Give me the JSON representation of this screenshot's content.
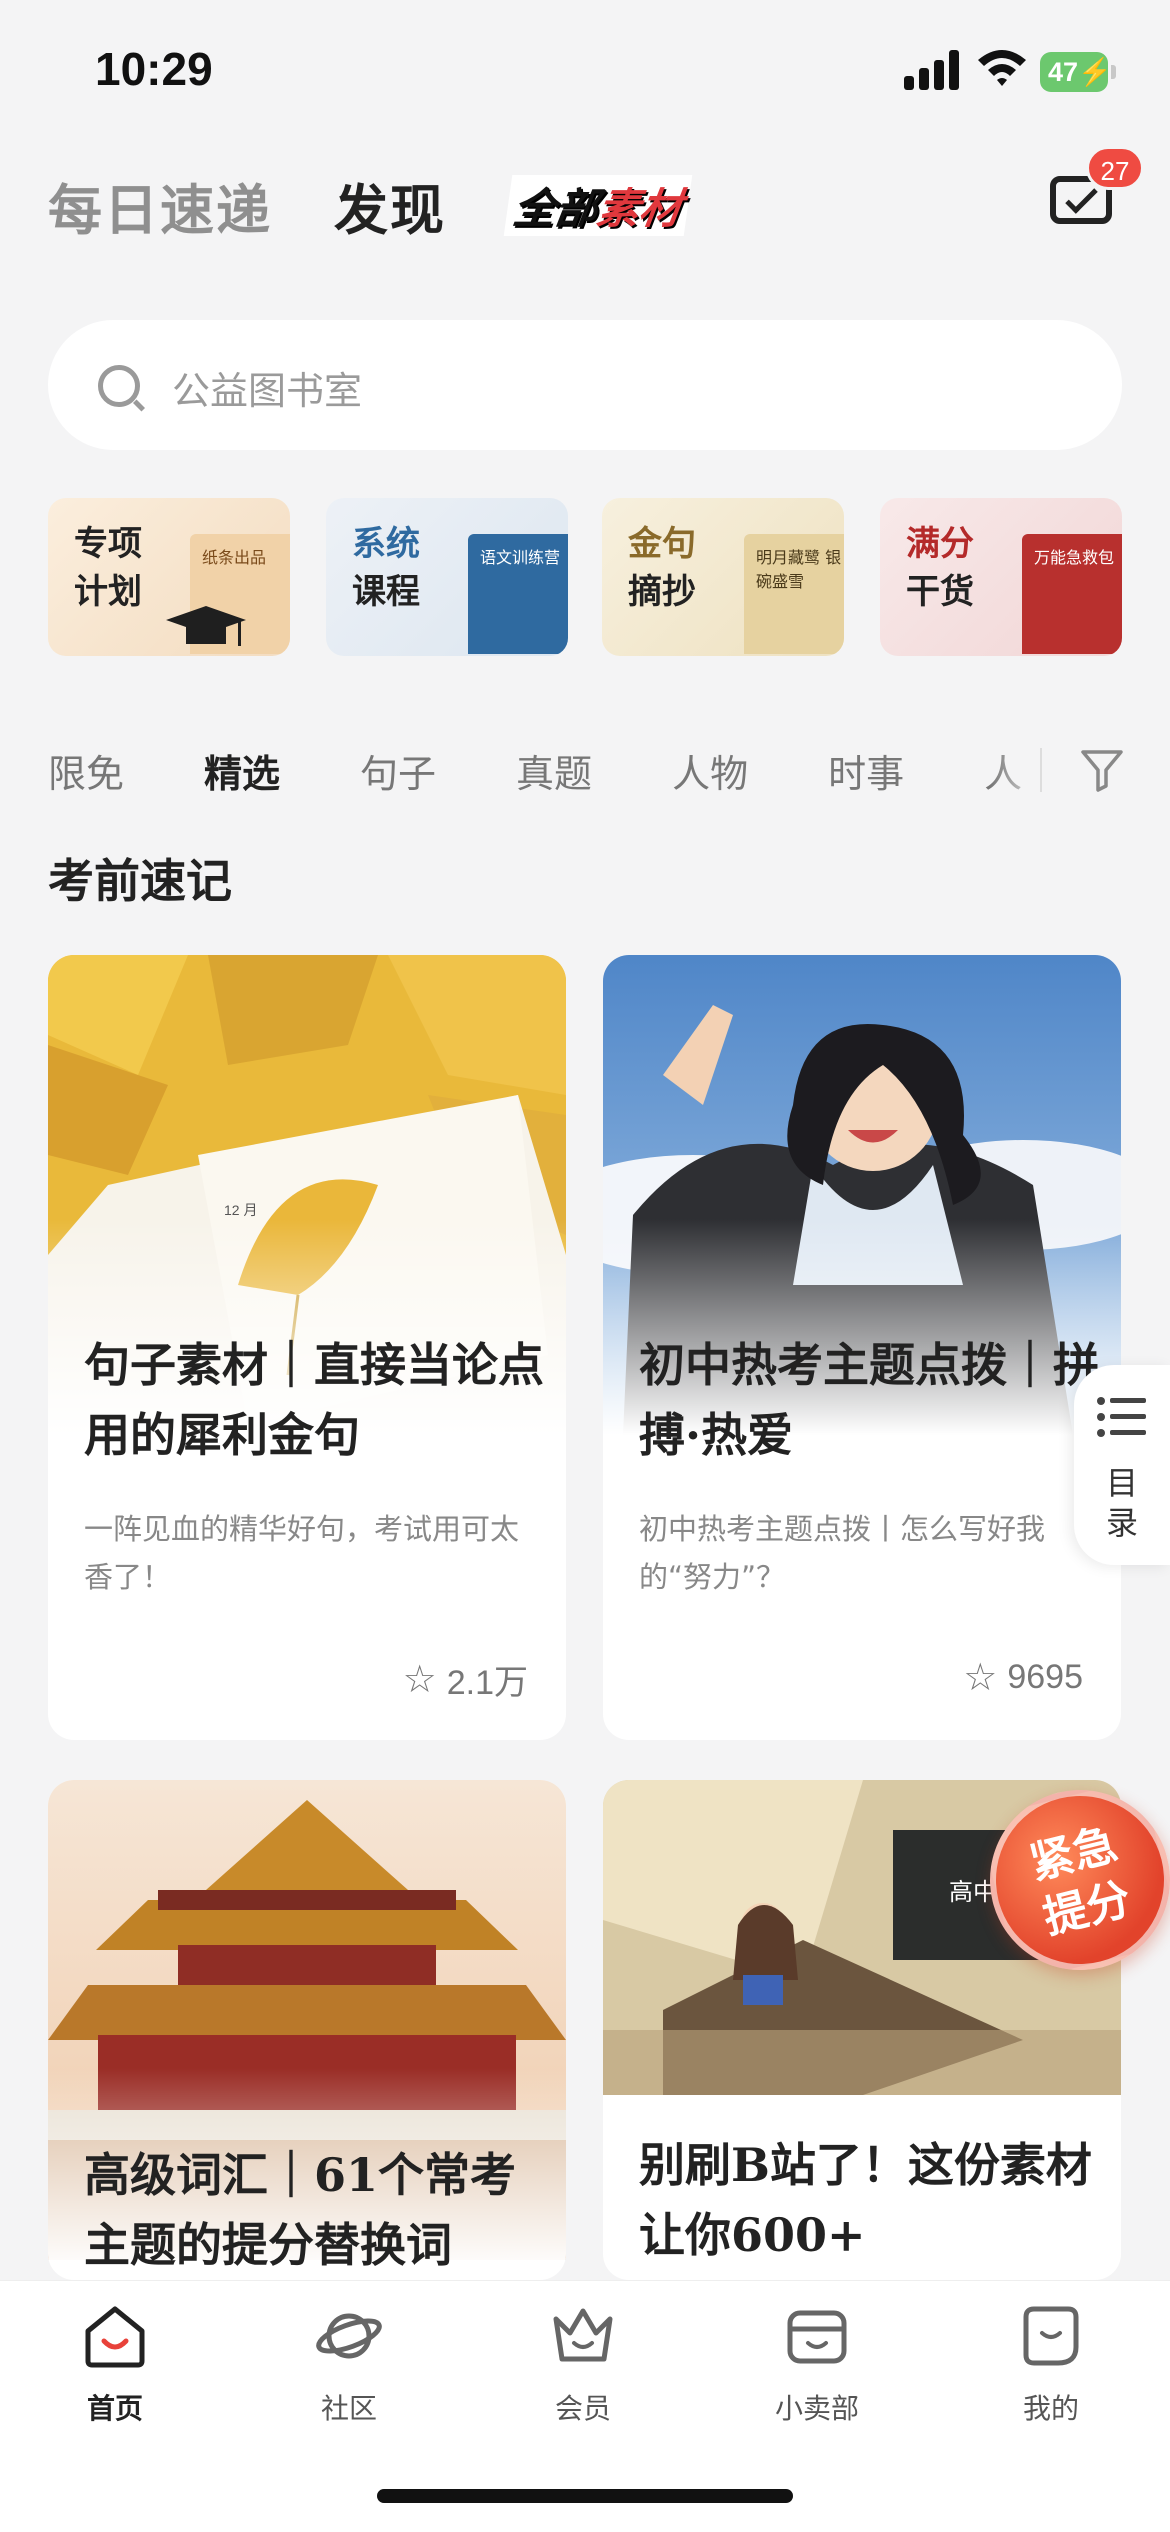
{
  "status": {
    "time": "10:29",
    "battery": "47"
  },
  "top_tabs": [
    {
      "label": "每日速递",
      "active": false
    },
    {
      "label": "发现",
      "active": true
    }
  ],
  "brand": {
    "part1": "全部",
    "part2": "素材"
  },
  "mail": {
    "badge": "27",
    "icon": "mail-icon"
  },
  "search": {
    "placeholder": "公益图书室",
    "icon": "search-icon"
  },
  "features": [
    {
      "line1": "专项",
      "line2": "计划",
      "book_text": "纸条出品",
      "accent": "#b26a2c"
    },
    {
      "line1": "系统",
      "line2": "课程",
      "book_text": "语文训练营",
      "accent": "#2f6aa0"
    },
    {
      "line1": "金句",
      "line2": "摘抄",
      "book_text": "明月藏鹭 银碗盛雪",
      "accent": "#8a6a2a"
    },
    {
      "line1": "满分",
      "line2": "干货",
      "book_text": "万能急救包",
      "accent": "#b42a2a"
    }
  ],
  "categories": [
    {
      "label": "限免",
      "active": false
    },
    {
      "label": "精选",
      "active": true
    },
    {
      "label": "句子",
      "active": false
    },
    {
      "label": "真题",
      "active": false
    },
    {
      "label": "人物",
      "active": false
    },
    {
      "label": "时事",
      "active": false
    },
    {
      "label": "人",
      "active": false
    }
  ],
  "section_title": "考前速记",
  "cards": [
    {
      "title": "句子素材｜直接当论点用的犀利金句",
      "desc": "一阵见血的精华好句，考试用可太香了！",
      "favorites": "2.1万"
    },
    {
      "title": "初中热考主题点拨｜拼搏·热爱",
      "desc": "初中热考主题点拨丨怎么写好我的“努力”？",
      "favorites": "9695"
    },
    {
      "title": "高级词汇｜61个常考主题的提分替换词",
      "desc": "",
      "favorites": ""
    },
    {
      "title": "别刷B站了！这份素材让你600+",
      "desc": "",
      "favorites": ""
    }
  ],
  "directory": {
    "label": "目录"
  },
  "urgent": {
    "line1": "紧急",
    "line2": "提分"
  },
  "classroom_board": "高中",
  "nav": [
    {
      "label": "首页",
      "icon": "home-icon",
      "active": true
    },
    {
      "label": "社区",
      "icon": "planet-icon",
      "active": false
    },
    {
      "label": "会员",
      "icon": "crown-icon",
      "active": false
    },
    {
      "label": "小卖部",
      "icon": "shop-icon",
      "active": false
    },
    {
      "label": "我的",
      "icon": "profile-icon",
      "active": false
    }
  ]
}
